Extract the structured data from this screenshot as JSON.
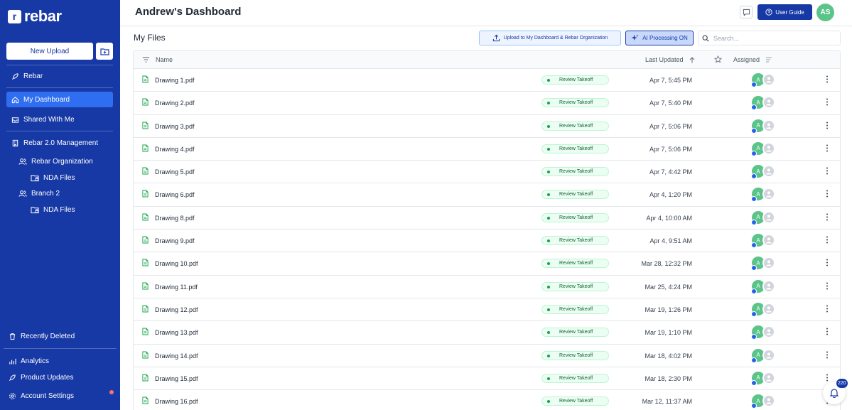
{
  "brand": {
    "name": "rebar",
    "logo_letter": "r",
    "color": "#1739a6"
  },
  "sidebar": {
    "new_upload_label": "New Upload",
    "items": [
      {
        "label": "Rebar",
        "icon": "rocket-icon"
      },
      {
        "label": "My Dashboard",
        "icon": "home-icon",
        "active": true
      },
      {
        "label": "Shared With Me",
        "icon": "inbox-icon"
      },
      {
        "label": "Rebar 2.0 Management",
        "icon": "building-icon"
      },
      {
        "label": "Rebar Organization",
        "icon": "users-icon"
      },
      {
        "label": "NDA Files",
        "icon": "folder-lock-icon"
      },
      {
        "label": "Branch 2",
        "icon": "users-icon"
      },
      {
        "label": "NDA Files",
        "icon": "folder-lock-icon"
      }
    ],
    "footer": [
      {
        "label": "Recently Deleted",
        "icon": "trash-icon"
      },
      {
        "label": "Analytics",
        "icon": "chart-icon"
      },
      {
        "label": "Product Updates",
        "icon": "rocket-icon"
      },
      {
        "label": "Account Settings",
        "icon": "gear-icon"
      }
    ]
  },
  "header": {
    "title": "Andrew's Dashboard",
    "user_guide_label": "User Guide",
    "avatar_initials": "AS"
  },
  "files": {
    "title": "My Files",
    "upload_to_label": "Upload to My Dashboard & Rebar Organization",
    "ai_label": "AI Processing ON",
    "search_placeholder": "Search..."
  },
  "table": {
    "columns": {
      "name": "Name",
      "updated": "Last Updated",
      "assigned": "Assigned"
    },
    "rows": [
      {
        "name": "Drawing 1.pdf",
        "status": "Review Takeoff",
        "updated": "Apr 7, 5:45 PM",
        "assignee": "A"
      },
      {
        "name": "Drawing 2.pdf",
        "status": "Review Takeoff",
        "updated": "Apr 7, 5:40 PM",
        "assignee": "A"
      },
      {
        "name": "Drawing 3.pdf",
        "status": "Review Takeoff",
        "updated": "Apr 7, 5:06 PM",
        "assignee": "A"
      },
      {
        "name": "Drawing 4.pdf",
        "status": "Review Takeoff",
        "updated": "Apr 7, 5:06 PM",
        "assignee": "A"
      },
      {
        "name": "Drawing 5.pdf",
        "status": "Review Takeoff",
        "updated": "Apr 7, 4:42 PM",
        "assignee": "A"
      },
      {
        "name": "Drawing 6.pdf",
        "status": "Review Takeoff",
        "updated": "Apr 4, 1:20 PM",
        "assignee": "A"
      },
      {
        "name": "Drawing 8.pdf",
        "status": "Review Takeoff",
        "updated": "Apr 4, 10:00 AM",
        "assignee": "A"
      },
      {
        "name": "Drawing 9.pdf",
        "status": "Review Takeoff",
        "updated": "Apr 4, 9:51 AM",
        "assignee": "A"
      },
      {
        "name": "Drawing 10.pdf",
        "status": "Review Takeoff",
        "updated": "Mar 28, 12:32 PM",
        "assignee": "A"
      },
      {
        "name": "Drawing 11.pdf",
        "status": "Review Takeoff",
        "updated": "Mar 25, 4:24 PM",
        "assignee": "A"
      },
      {
        "name": "Drawing 12.pdf",
        "status": "Review Takeoff",
        "updated": "Mar 19, 1:26 PM",
        "assignee": "A"
      },
      {
        "name": "Drawing 13.pdf",
        "status": "Review Takeoff",
        "updated": "Mar 19, 1:10 PM",
        "assignee": "A"
      },
      {
        "name": "Drawing 14.pdf",
        "status": "Review Takeoff",
        "updated": "Mar 18, 4:02 PM",
        "assignee": "A"
      },
      {
        "name": "Drawing 15.pdf",
        "status": "Review Takeoff",
        "updated": "Mar 18, 2:30 PM",
        "assignee": "A"
      },
      {
        "name": "Drawing 16.pdf",
        "status": "Review Takeoff",
        "updated": "Mar 12, 11:37 AM",
        "assignee": "A"
      }
    ]
  },
  "notifications": {
    "count": "220"
  }
}
